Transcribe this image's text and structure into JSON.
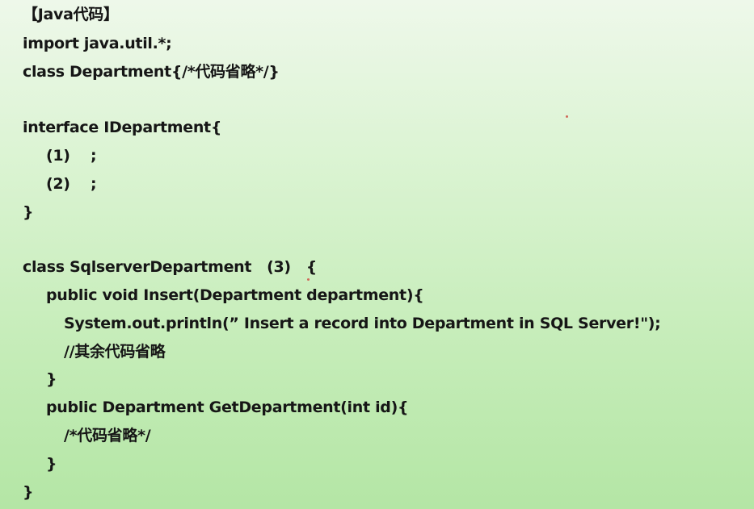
{
  "lines": [
    "【Java代码】",
    "import java.util.*;",
    "class Department{/*代码省略*/}",
    "interface IDepartment{",
    "(1)    ;",
    "(2)    ;",
    "}",
    "class SqlserverDepartment   (3)   {",
    "public void Insert(Department department){",
    "System.out.println(” Insert a record into Department in SQL Server!\");",
    "//其余代码省略",
    "}",
    "public Department GetDepartment(int id){",
    "/*代码省略*/",
    "}",
    "}"
  ]
}
